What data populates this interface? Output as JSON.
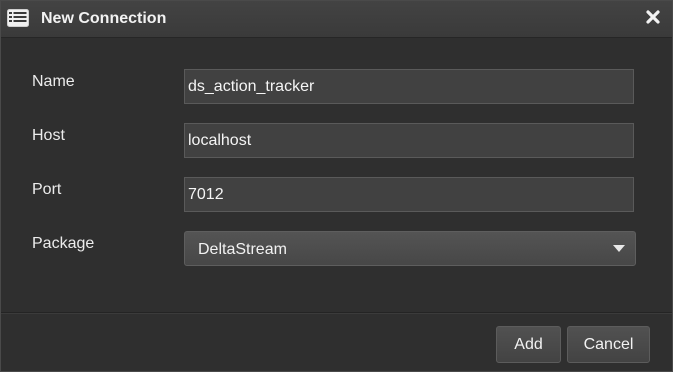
{
  "window": {
    "title": "New Connection",
    "icon": "list-window-icon",
    "close_icon": "close-icon"
  },
  "form": {
    "name": {
      "label": "Name",
      "value": "ds_action_tracker"
    },
    "host": {
      "label": "Host",
      "value": "localhost"
    },
    "port": {
      "label": "Port",
      "value": "7012"
    },
    "package": {
      "label": "Package",
      "selected": "DeltaStream",
      "icon": "chevron-down-icon"
    }
  },
  "footer": {
    "add_label": "Add",
    "cancel_label": "Cancel"
  },
  "colors": {
    "background": "#2f2f2f",
    "titlebar": "#3e3e3e",
    "input_bg": "#414141",
    "text": "#f2f2f2"
  }
}
